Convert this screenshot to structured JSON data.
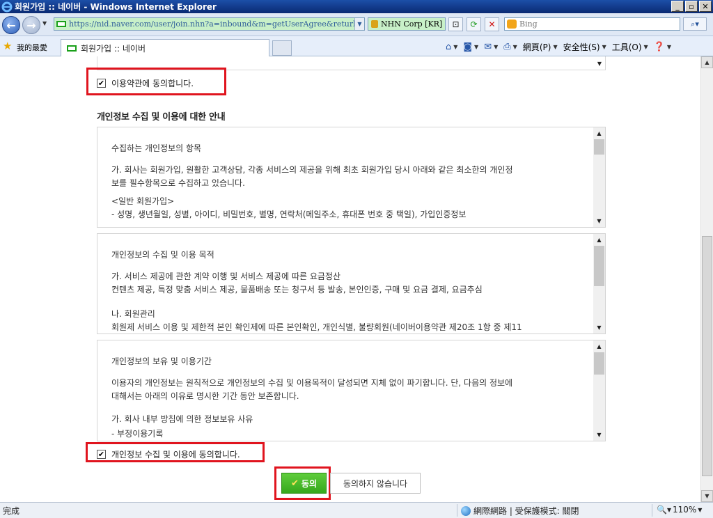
{
  "window": {
    "title": "회원가입 :: 네이버 - Windows Internet Explorer",
    "buttons": {
      "minimize": "_",
      "maximize": "▫",
      "close": "✕"
    }
  },
  "address_bar": {
    "url": "https://nid.naver.com/user/join.nhn?a=inbound&m=getUserAgree&returl=#pos3",
    "cert": "NHN Corp [KR]",
    "search_placeholder": "Bing"
  },
  "favorites": {
    "label": "我的最愛",
    "tab_title": "회원가입 :: 네이버"
  },
  "command_bar": {
    "page": "網頁(P)",
    "safety": "安全性(S)",
    "tools": "工具(O)"
  },
  "content": {
    "terms_agree_label": "이용약관에 동의합니다.",
    "section_title": "개인정보 수집 및 이용에 대한 안내",
    "policy_boxes": [
      {
        "lines": [
          "수집하는 개인정보의 항목",
          "",
          "가. 회사는 회원가입, 원활한 고객상담, 각종 서비스의 제공을 위해 최초 회원가입 당시 아래와 같은 최소한의 개인정",
          "보를 필수항목으로 수집하고 있습니다.",
          "",
          "<일반 회원가입>",
          "- 성명, 생년월일, 성별, 아이디, 비밀번호, 별명, 연락처(메일주소, 휴대폰 번호 중 택일), 가입인증정보"
        ]
      },
      {
        "lines": [
          "개인정보의 수집 및 이용 목적",
          "",
          "가. 서비스 제공에 관한 계약 이행 및 서비스 제공에 따른 요금정산",
          "컨텐츠 제공, 특정 맞춤 서비스 제공, 물품배송 또는 청구서 등 발송, 본인인증, 구매 및 요금 결제, 요금추심",
          "",
          "나. 회원관리",
          "회원제 서비스 이용 및 제한적 본인 확인제에 따른 본인확인, 개인식별, 불량회원(네이버이용약관 제20조 1항 중 제11"
        ]
      },
      {
        "lines": [
          "개인정보의 보유 및 이용기간",
          "",
          "이용자의 개인정보는 원칙적으로 개인정보의 수집 및 이용목적이 달성되면 지체 없이 파기합니다. 단, 다음의 정보에",
          "대해서는 아래의 이유로 명시한 기간 동안 보존합니다.",
          "",
          "가. 회사 내부 방침에 의한 정보보유 사유",
          "- 부정이용기록"
        ]
      }
    ],
    "privacy_agree_label": "개인정보 수집 및 이용에 동의합니다.",
    "agree_button": "동의",
    "disagree_button": "동의하지 않습니다",
    "checkbox_mark": "✔"
  },
  "status_bar": {
    "status": "完成",
    "zone": "網際網路 | 受保護模式: 關閉",
    "zoom": "110%"
  }
}
